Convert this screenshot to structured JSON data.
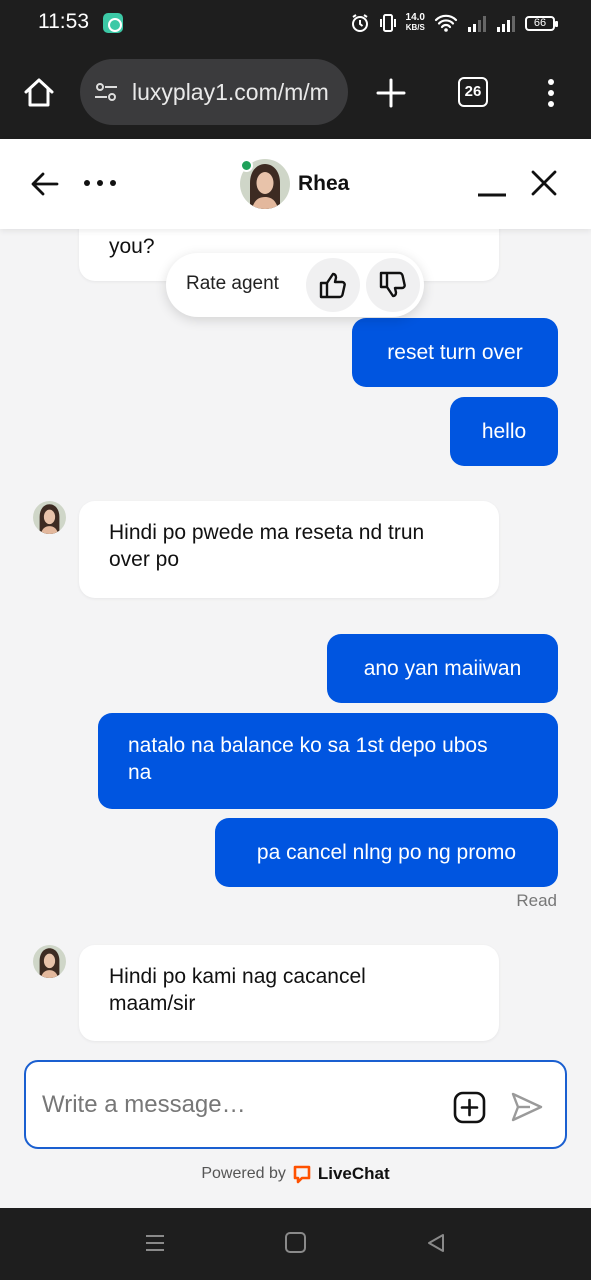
{
  "status_bar": {
    "time": "11:53",
    "net_speed_value": "14.0",
    "net_speed_unit": "KB/S",
    "battery": "66"
  },
  "browser": {
    "url": "luxyplay1.com/m/m",
    "tab_count": "26"
  },
  "chat_header": {
    "agent_name": "Rhea",
    "agent_online": true
  },
  "rating": {
    "label": "Rate agent"
  },
  "messages": [
    {
      "sender": "agent",
      "text": "you?"
    },
    {
      "sender": "visitor",
      "text": "reset turn over"
    },
    {
      "sender": "visitor",
      "text": "hello"
    },
    {
      "sender": "agent",
      "line1": "Hindi po pwede ma reseta nd trun",
      "line2": "over po"
    },
    {
      "sender": "visitor",
      "text": "ano yan maiiwan"
    },
    {
      "sender": "visitor",
      "line1": "natalo na balance ko sa 1st depo ubos",
      "line2": "na"
    },
    {
      "sender": "visitor",
      "text": "pa cancel nlng po ng promo"
    },
    {
      "sender": "agent",
      "line1": "Hindi po kami nag cacancel",
      "line2": "maam/sir"
    }
  ],
  "read_status": "Read",
  "composer": {
    "placeholder": "Write a message…",
    "value": ""
  },
  "footer": {
    "powered_by": "Powered by",
    "brand": "LiveChat"
  },
  "colors": {
    "accent": "#0055e0",
    "online": "#1fa15a",
    "livechat_brand": "#ff5100"
  }
}
